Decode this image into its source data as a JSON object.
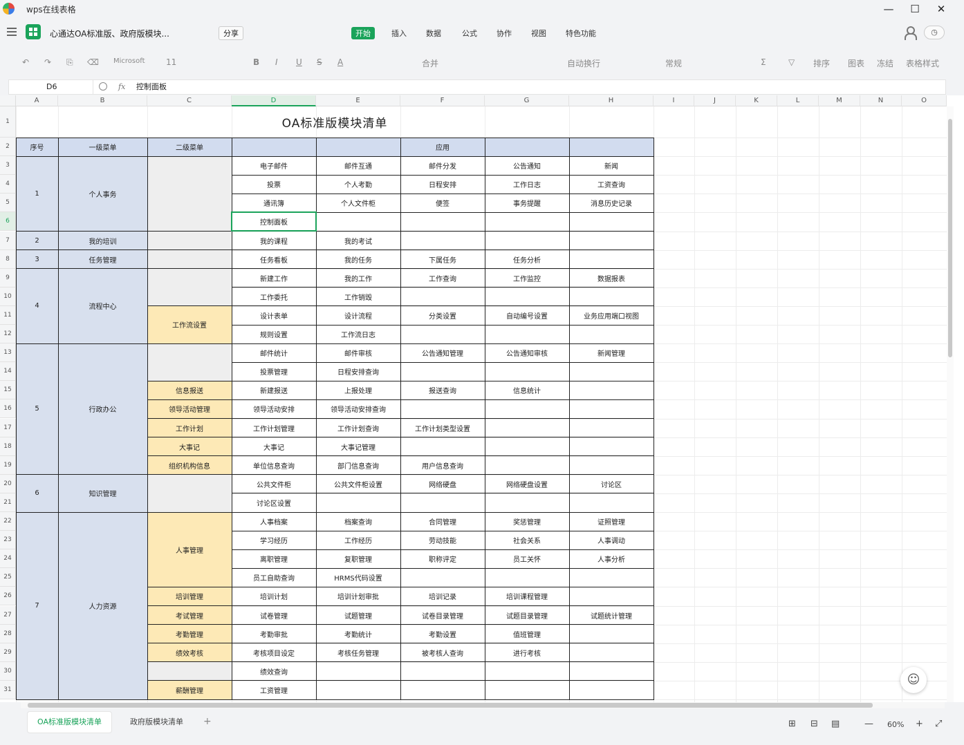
{
  "window": {
    "title": "wps在线表格",
    "controls": {
      "minimize": "—",
      "maximize": "☐",
      "close": "✕"
    }
  },
  "menubar": {
    "doc_title": "心通达OA标准版、政府版模块...",
    "share_label": "分享",
    "tabs": [
      "开始",
      "插入",
      "数据",
      "公式",
      "协作",
      "视图",
      "特色功能"
    ],
    "active_tab": "开始"
  },
  "toolbar": {
    "undo": "↶",
    "redo": "↷",
    "paint": "⎘",
    "clear": "⌫",
    "font_name": "Microsoft",
    "font_size": "11",
    "bold": "B",
    "italic": "I",
    "underline": "U",
    "strike": "S",
    "font_color": "A",
    "merge": "合并",
    "wrap": "自动换行",
    "format": "常规",
    "sum": "Σ",
    "filter": "▽",
    "sort": "排序",
    "chart": "图表",
    "freeze": "冻结",
    "table": "表格样式"
  },
  "formula_bar": {
    "cell_ref": "D6",
    "fx": "fx",
    "content": "控制面板"
  },
  "columns": [
    "A",
    "B",
    "C",
    "D",
    "E",
    "F",
    "G",
    "H",
    "I",
    "J",
    "K",
    "L",
    "M",
    "N",
    "O"
  ],
  "selected_column": "D",
  "rows": [
    "1",
    "2",
    "3",
    "4",
    "5",
    "6",
    "7",
    "8",
    "9",
    "10",
    "11",
    "12",
    "13",
    "14",
    "15",
    "16",
    "17",
    "18",
    "19",
    "20",
    "21",
    "22",
    "23",
    "24",
    "25",
    "26",
    "27",
    "28",
    "29",
    "30",
    "31"
  ],
  "selected_row": "6",
  "sheet": {
    "title": "OA标准版模块清单",
    "headers": {
      "seq": "序号",
      "level1": "一级菜单",
      "level2": "二级菜单",
      "apps": "应用"
    },
    "groups": [
      {
        "seq": "1",
        "level1": "个人事务"
      },
      {
        "seq": "2",
        "level1": "我的培训"
      },
      {
        "seq": "3",
        "level1": "任务管理"
      },
      {
        "seq": "4",
        "level1": "流程中心"
      },
      {
        "seq": "5",
        "level1": "行政办公"
      },
      {
        "seq": "6",
        "level1": "知识管理"
      },
      {
        "seq": "7",
        "level1": "人力资源"
      }
    ],
    "level2": {
      "r11": "工作流设置",
      "r15": "信息报送",
      "r16": "领导活动管理",
      "r17": "工作计划",
      "r18": "大事记",
      "r19": "组织机构信息",
      "r22": "人事管理",
      "r26": "培训管理",
      "r27": "考试管理",
      "r28": "考勤管理",
      "r29": "绩效考核",
      "r31": "薪酬管理"
    },
    "apps": {
      "r3": [
        "电子邮件",
        "邮件互通",
        "邮件分发",
        "公告通知",
        "新闻"
      ],
      "r4": [
        "投票",
        "个人考勤",
        "日程安排",
        "工作日志",
        "工资查询"
      ],
      "r5": [
        "通讯簿",
        "个人文件柜",
        "便签",
        "事务提醒",
        "消息历史记录"
      ],
      "r6": [
        "控制面板",
        "",
        "",
        "",
        ""
      ],
      "r7": [
        "我的课程",
        "我的考试",
        "",
        "",
        ""
      ],
      "r8": [
        "任务看板",
        "我的任务",
        "下属任务",
        "任务分析",
        ""
      ],
      "r9": [
        "新建工作",
        "我的工作",
        "工作查询",
        "工作监控",
        "数据报表"
      ],
      "r10": [
        "工作委托",
        "工作销毁",
        "",
        "",
        ""
      ],
      "r11": [
        "设计表单",
        "设计流程",
        "分类设置",
        "自动编号设置",
        "业务应用端口视图"
      ],
      "r12": [
        "规则设置",
        "工作流日志",
        "",
        "",
        ""
      ],
      "r13": [
        "邮件统计",
        "邮件审核",
        "公告通知管理",
        "公告通知审核",
        "新闻管理"
      ],
      "r14": [
        "投票管理",
        "日程安排查询",
        "",
        "",
        ""
      ],
      "r15": [
        "新建报送",
        "上报处理",
        "报送查询",
        "信息统计",
        ""
      ],
      "r16": [
        "领导活动安排",
        "领导活动安排查询",
        "",
        "",
        ""
      ],
      "r17": [
        "工作计划管理",
        "工作计划查询",
        "工作计划类型设置",
        "",
        ""
      ],
      "r18": [
        "大事记",
        "大事记管理",
        "",
        "",
        ""
      ],
      "r19": [
        "单位信息查询",
        "部门信息查询",
        "用户信息查询",
        "",
        ""
      ],
      "r20": [
        "公共文件柜",
        "公共文件柜设置",
        "网络硬盘",
        "网络硬盘设置",
        "讨论区"
      ],
      "r21": [
        "讨论区设置",
        "",
        "",
        "",
        ""
      ],
      "r22": [
        "人事档案",
        "档案查询",
        "合同管理",
        "奖惩管理",
        "证照管理"
      ],
      "r23": [
        "学习经历",
        "工作经历",
        "劳动技能",
        "社会关系",
        "人事调动"
      ],
      "r24": [
        "离职管理",
        "复职管理",
        "职称评定",
        "员工关怀",
        "人事分析"
      ],
      "r25": [
        "员工自助查询",
        "HRMS代码设置",
        "",
        "",
        ""
      ],
      "r26": [
        "培训计划",
        "培训计划审批",
        "培训记录",
        "培训课程管理",
        ""
      ],
      "r27": [
        "试卷管理",
        "试题管理",
        "试卷目录管理",
        "试题目录管理",
        "试题统计管理"
      ],
      "r28": [
        "考勤审批",
        "考勤统计",
        "考勤设置",
        "值班管理",
        ""
      ],
      "r29": [
        "考核项目设定",
        "考核任务管理",
        "被考核人查询",
        "进行考核",
        ""
      ],
      "r30": [
        "绩效查询",
        "",
        "",
        "",
        ""
      ],
      "r31": [
        "工资管理",
        "",
        "",
        "",
        ""
      ]
    }
  },
  "sheet_tabs": [
    "OA标准版模块清单",
    "政府版模块清单"
  ],
  "active_sheet": "OA标准版模块清单",
  "add_sheet_label": "+",
  "status": {
    "view_normal": "⊞",
    "view_page": "⊟",
    "view_read": "▤",
    "zoom_out": "—",
    "zoom": "60%",
    "zoom_in": "+",
    "fullscreen": "⤢"
  },
  "assistant_icon": "☺",
  "colors": {
    "accent": "#1aa35a",
    "header_fill": "#d2dcef",
    "group_fill": "#d8e0ee",
    "level2_fill": "#fde9b6",
    "level2_blank_fill": "#eeeeee"
  }
}
